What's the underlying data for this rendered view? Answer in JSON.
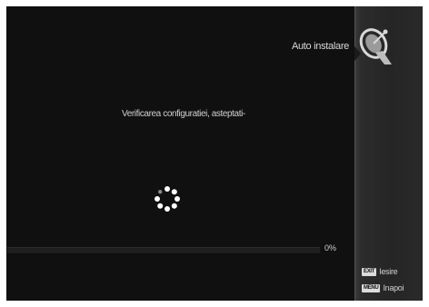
{
  "header": {
    "title": "Auto instalare",
    "icon": "satellite-dish-icon"
  },
  "main": {
    "status_message": "Verificarea configuratiei, asteptati-",
    "progress": {
      "value": 0,
      "label": "0%"
    }
  },
  "footer": {
    "hints": [
      {
        "key": "EXIT",
        "label": "Iesire"
      },
      {
        "key": "MENU",
        "label": "Inapoi"
      }
    ]
  },
  "colors": {
    "background": "#101010",
    "text": "#d8d8d8",
    "side_panel": "#2a2a2a"
  }
}
